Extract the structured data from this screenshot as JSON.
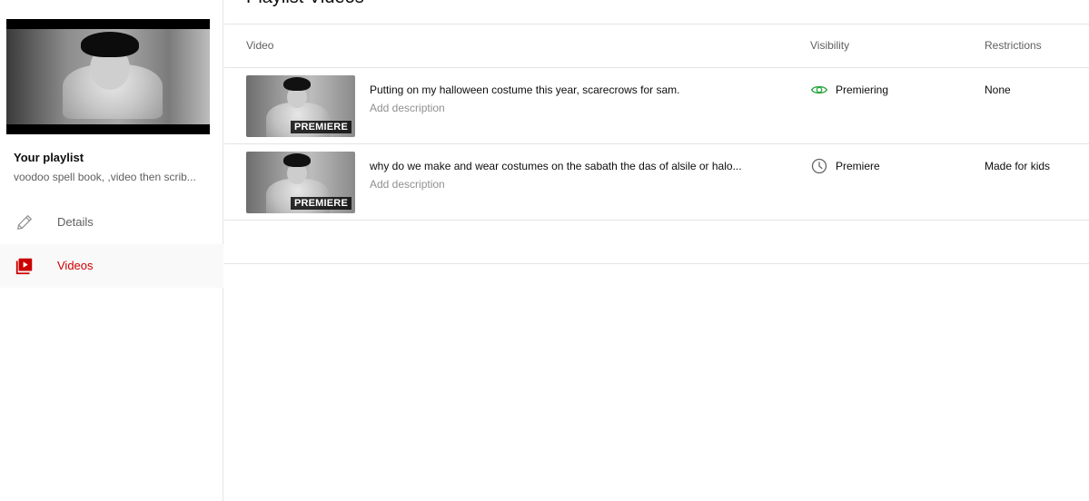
{
  "sidebar": {
    "playlist_title": "Your playlist",
    "playlist_description": "voodoo spell book, ,video then scrib...",
    "nav": [
      {
        "label": "Details",
        "icon": "pencil-icon"
      },
      {
        "label": "Videos",
        "icon": "video-icon",
        "active": true
      }
    ]
  },
  "main": {
    "title": "Playlist Videos",
    "columns": [
      "Video",
      "Visibility",
      "Restrictions"
    ],
    "rows": [
      {
        "badge": "PREMIERE",
        "title": "Putting on my halloween costume this year, scarecrows for sam.",
        "description": "Add description",
        "visibility": "Premiering",
        "visibility_icon": "eye-icon",
        "restrictions": "None"
      },
      {
        "badge": "PREMIERE",
        "title": "why do we make and wear costumes on the sabath the das of alsile or halo...",
        "description": "Add description",
        "visibility": "Premiere",
        "visibility_icon": "clock-icon",
        "restrictions": "Made for kids"
      }
    ]
  },
  "colors": {
    "accent": "#cc0000",
    "visibility_green": "#2ba640",
    "text_secondary": "#606060",
    "divider": "#e5e5e5"
  }
}
